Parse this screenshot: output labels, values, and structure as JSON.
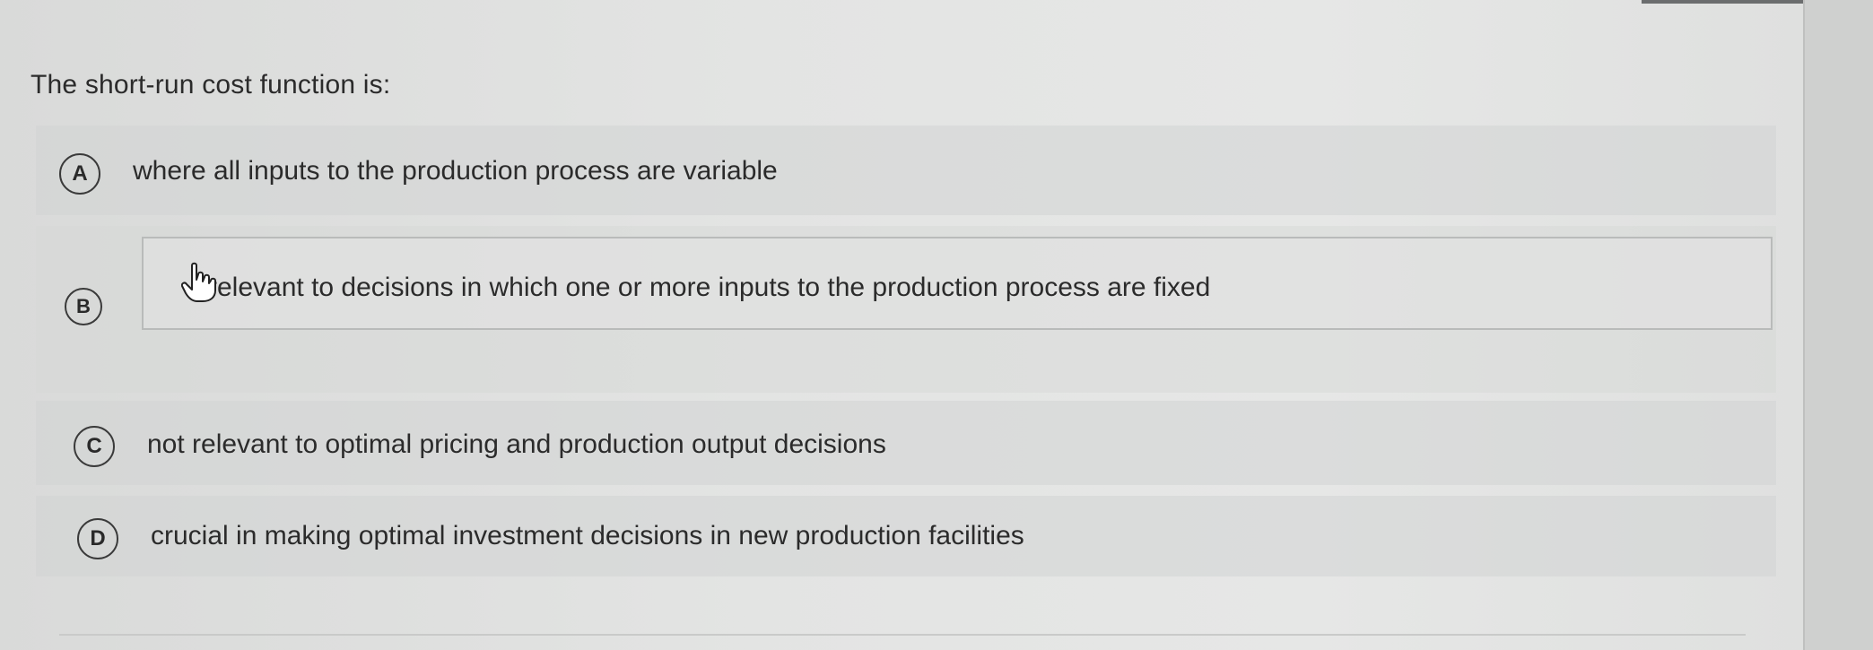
{
  "question": {
    "text": "The short-run cost function is:"
  },
  "options": [
    {
      "letter": "A",
      "text": "where all inputs to the production process are variable"
    },
    {
      "letter": "B",
      "text": "relevant to decisions in which one or more inputs to the production process are fixed",
      "hovered": true
    },
    {
      "letter": "C",
      "text": "not relevant to optimal pricing and production output decisions"
    },
    {
      "letter": "D",
      "text": "crucial in making optimal investment decisions in new production facilities"
    }
  ],
  "cursor": {
    "icon": "hand-pointer-icon"
  }
}
